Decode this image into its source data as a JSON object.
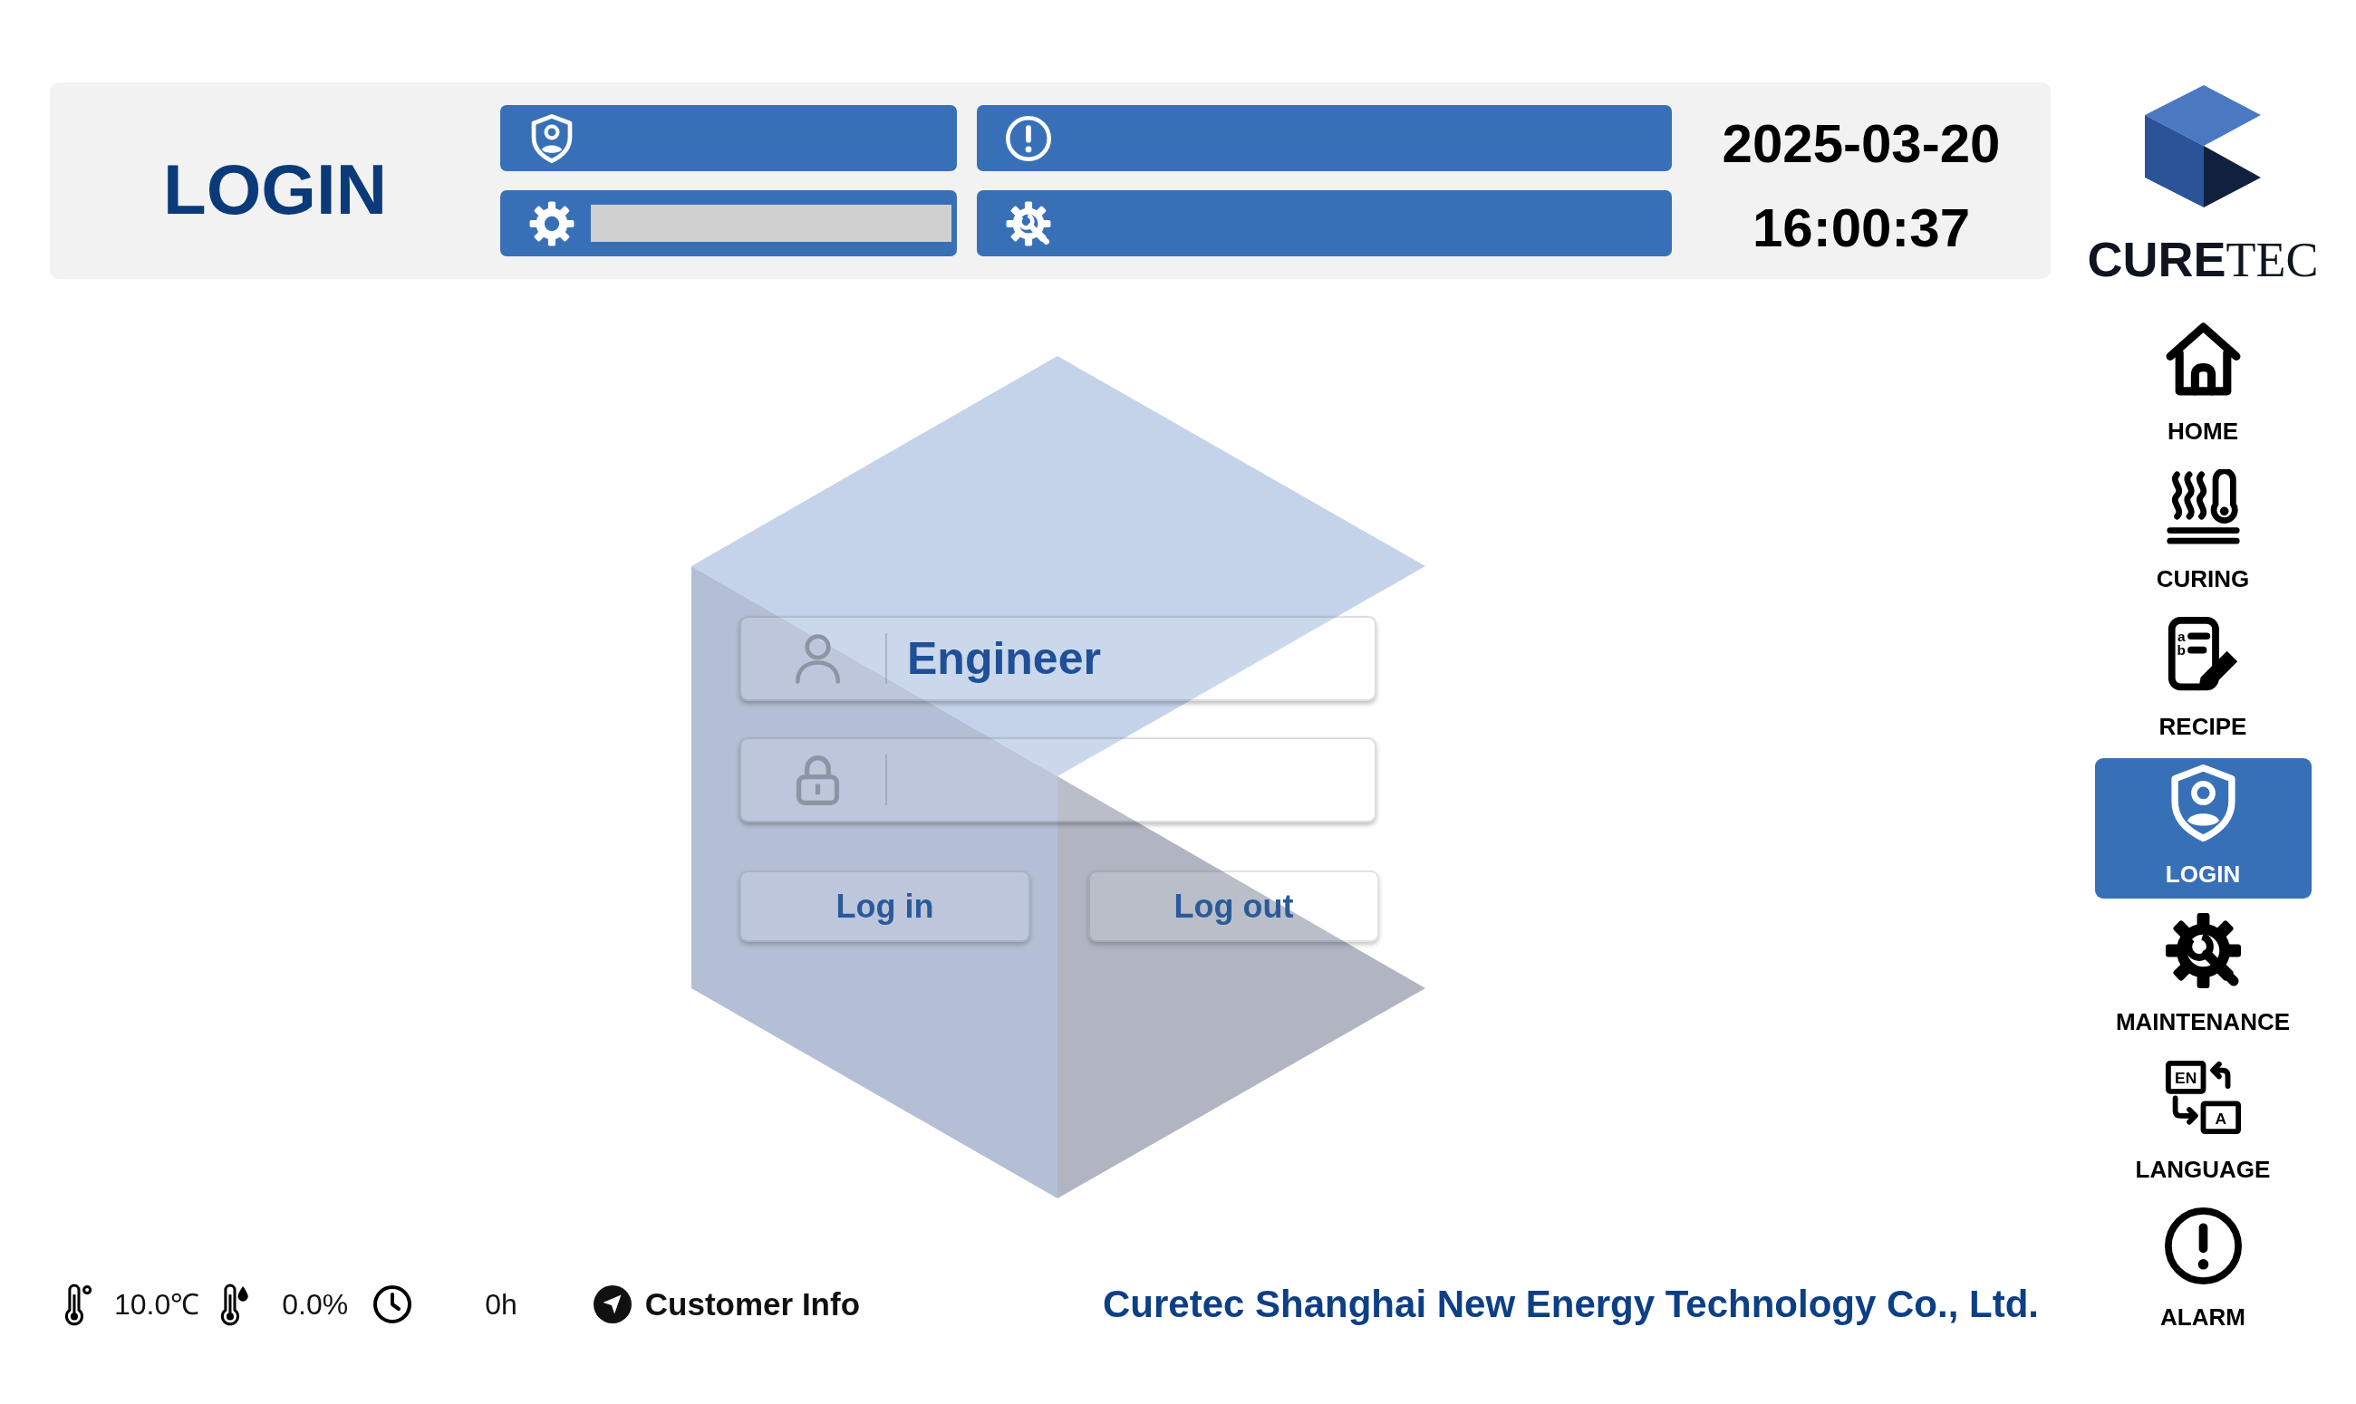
{
  "header": {
    "title": "LOGIN",
    "status_bars": [
      {
        "kind": "plain"
      },
      {
        "kind": "plain"
      },
      {
        "kind": "field"
      },
      {
        "kind": "plain"
      }
    ],
    "date": "2025-03-20",
    "time": "16:00:37"
  },
  "login_form": {
    "fields": [
      {
        "kind": "username",
        "value": "Engineer"
      },
      {
        "kind": "password"
      }
    ],
    "buttons": [
      "Log in",
      "Log out"
    ]
  },
  "status_bar": {
    "readings": [
      {
        "kind": "temperature",
        "value": "10.0℃"
      },
      {
        "kind": "humidity",
        "value": "0.0%"
      },
      {
        "kind": "runtime",
        "value": "0h"
      }
    ],
    "customer_info": "Customer Info",
    "company": "Curetec Shanghai New Energy Technology Co., Ltd."
  },
  "logo": {
    "text": "**CURE**TEC"
  },
  "nav": [
    {
      "label": "HOME",
      "selected": false
    },
    {
      "label": "CURING",
      "selected": false
    },
    {
      "label": "RECIPE",
      "selected": false,
      "icon_texts": [
        "a",
        "b"
      ]
    },
    {
      "label": "LOGIN",
      "selected": true
    },
    {
      "label": "MAINTENANCE",
      "selected": false
    },
    {
      "label": "LANGUAGE",
      "selected": false,
      "icon_texts": [
        "EN",
        "A"
      ]
    },
    {
      "label": "ALARM",
      "selected": false
    }
  ]
}
